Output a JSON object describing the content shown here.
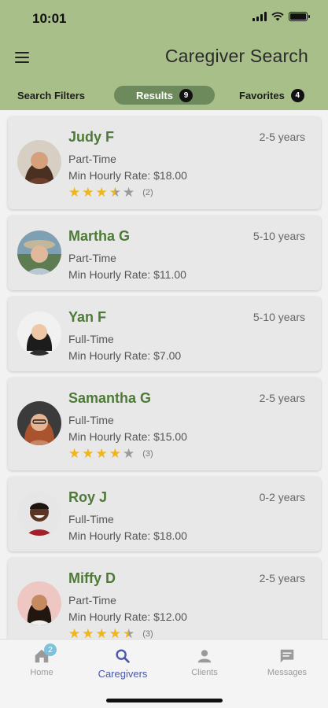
{
  "status_bar": {
    "time": "10:01"
  },
  "header": {
    "title": "Caregiver Search"
  },
  "tabs": {
    "filters": {
      "label": "Search Filters"
    },
    "results": {
      "label": "Results",
      "count": "9"
    },
    "favorites": {
      "label": "Favorites",
      "count": "4"
    }
  },
  "caregivers": [
    {
      "name": "Judy F",
      "experience": "2-5 years",
      "employment": "Part-Time",
      "rate": "Min Hourly Rate: $18.00",
      "rating": 3.5,
      "review_count": "(2)"
    },
    {
      "name": "Martha G",
      "experience": "5-10 years",
      "employment": "Part-Time",
      "rate": "Min Hourly Rate: $11.00"
    },
    {
      "name": "Yan F",
      "experience": "5-10 years",
      "employment": "Full-Time",
      "rate": "Min Hourly Rate: $7.00"
    },
    {
      "name": "Samantha G",
      "experience": "2-5 years",
      "employment": "Full-Time",
      "rate": "Min Hourly Rate: $15.00",
      "rating": 4,
      "review_count": "(3)"
    },
    {
      "name": "Roy J",
      "experience": "0-2 years",
      "employment": "Full-Time",
      "rate": "Min Hourly Rate: $18.00"
    },
    {
      "name": "Miffy D",
      "experience": "2-5 years",
      "employment": "Part-Time",
      "rate": "Min Hourly Rate: $12.00",
      "rating": 4.5,
      "review_count": "(3)"
    }
  ],
  "bottom_nav": {
    "home": {
      "label": "Home",
      "icon": "home-icon",
      "badge": "2"
    },
    "caregivers": {
      "label": "Caregivers",
      "icon": "search-icon"
    },
    "clients": {
      "label": "Clients",
      "icon": "person-icon"
    },
    "messages": {
      "label": "Messages",
      "icon": "message-icon"
    }
  },
  "colors": {
    "header_bg": "#a8bf8a",
    "active_tab": "#6d8a5c",
    "name_green": "#4e7a37",
    "star_gold": "#f0b51a",
    "nav_active": "#4b57a8"
  }
}
